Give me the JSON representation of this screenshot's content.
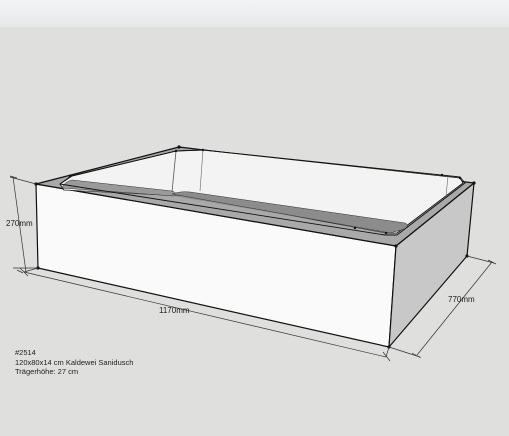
{
  "dimensions": {
    "height": "270mm",
    "length": "1170mm",
    "depth": "770mm"
  },
  "info": {
    "article_number": "#2514",
    "product": "120x80x14 cm Kaldewei Sanidusch",
    "carrier_height": "Trägerhöhe: 27 cm"
  },
  "colors": {
    "background": "#dfdfdd",
    "sky": "#e9ebec",
    "front_face": "#fafafa",
    "side_face": "#c9c9c9",
    "tray_floor": "#8e8e8e",
    "edge": "#111111"
  }
}
